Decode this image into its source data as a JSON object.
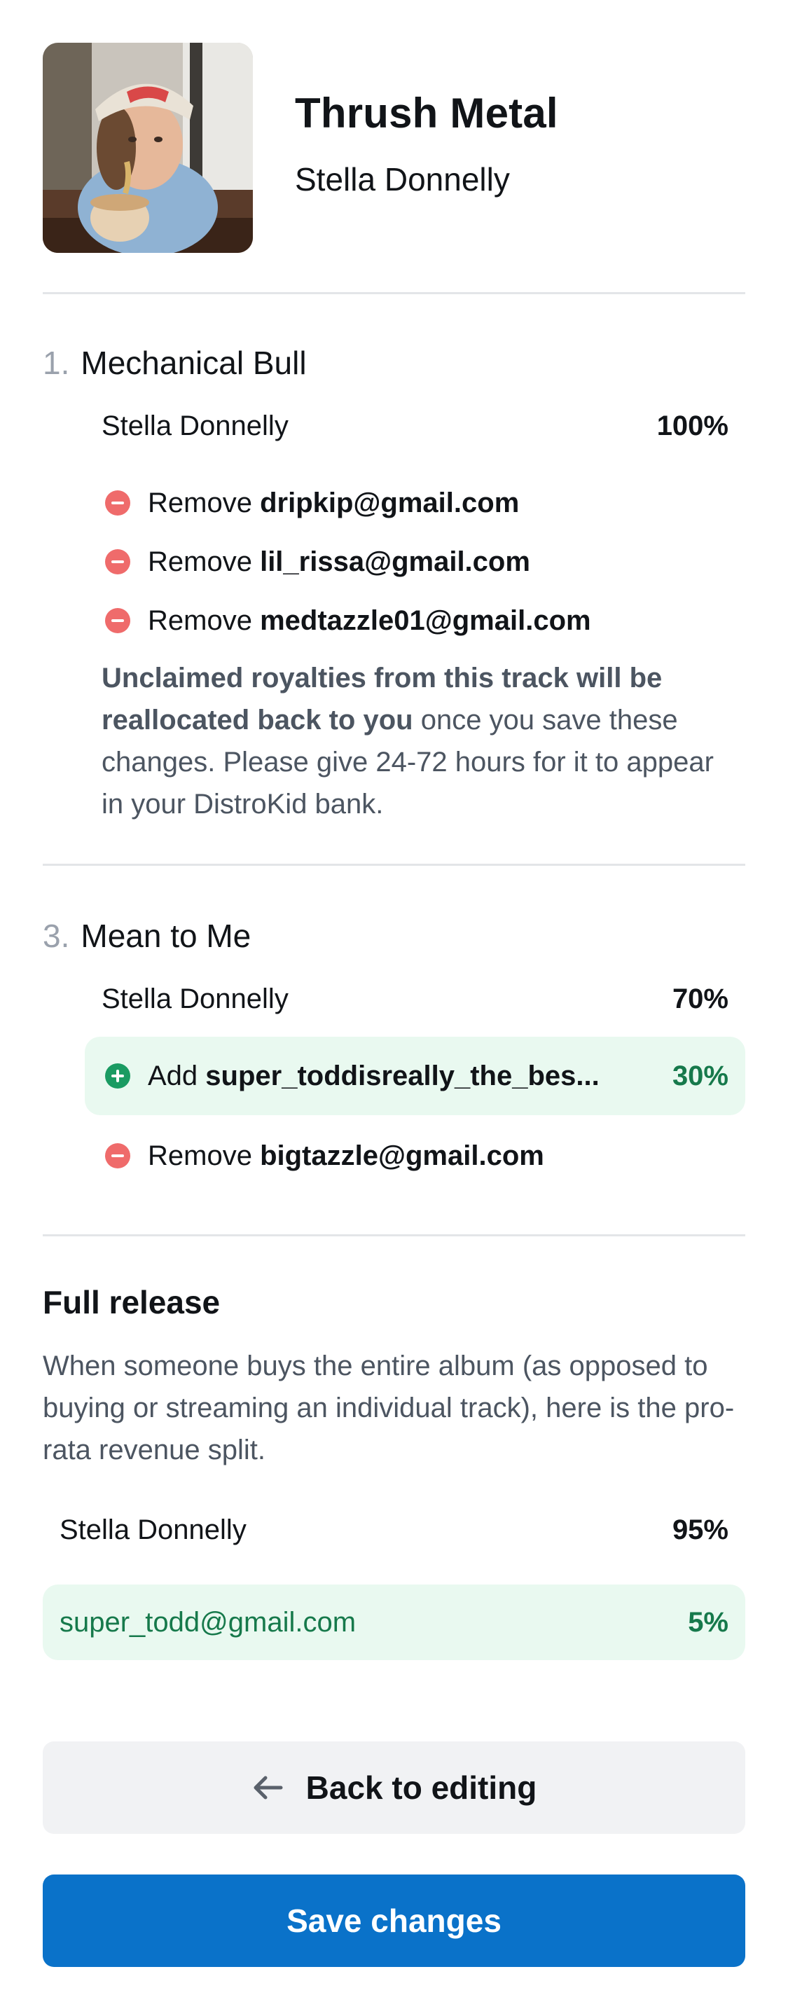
{
  "album": {
    "title": "Thrush Metal",
    "artist": "Stella Donnelly",
    "cover_icon": "album-cover-photo"
  },
  "tracks": [
    {
      "number": "1.",
      "title": "Mechanical Bull",
      "owner": {
        "name": "Stella Donnelly",
        "percent": "100%"
      },
      "changes": [
        {
          "action": "Remove",
          "email": "dripkip@gmail.com"
        },
        {
          "action": "Remove",
          "email": "lil_rissa@gmail.com"
        },
        {
          "action": "Remove",
          "email": "medtazzle01@gmail.com"
        }
      ],
      "note": {
        "bold": "Unclaimed royalties from this track will be reallocated back to you",
        "rest": " once you save these changes. Please give 24-72 hours for it to appear in your DistroKid bank."
      }
    },
    {
      "number": "3.",
      "title": "Mean to Me",
      "owner": {
        "name": "Stella Donnelly",
        "percent": "70%"
      },
      "add": {
        "action": "Add",
        "email": "super_toddisreally_the_bes...",
        "percent": "30%"
      },
      "changes": [
        {
          "action": "Remove",
          "email": "bigtazzle@gmail.com"
        }
      ]
    }
  ],
  "full_release": {
    "title": "Full release",
    "description": "When someone buys the entire album (as opposed to buying or streaming an individual track), here is the pro-rata revenue split.",
    "rows": [
      {
        "name": "Stella Donnelly",
        "percent": "95%"
      },
      {
        "name": "super_todd@gmail.com",
        "percent": "5%"
      }
    ]
  },
  "buttons": {
    "back_label": "Back to editing",
    "save_label": "Save changes"
  },
  "colors": {
    "remove": "#ef6b6b",
    "add": "#1a9b62",
    "add_bg": "#e9f9f0",
    "primary": "#0a72c9",
    "secondary_bg": "#f1f2f4"
  }
}
